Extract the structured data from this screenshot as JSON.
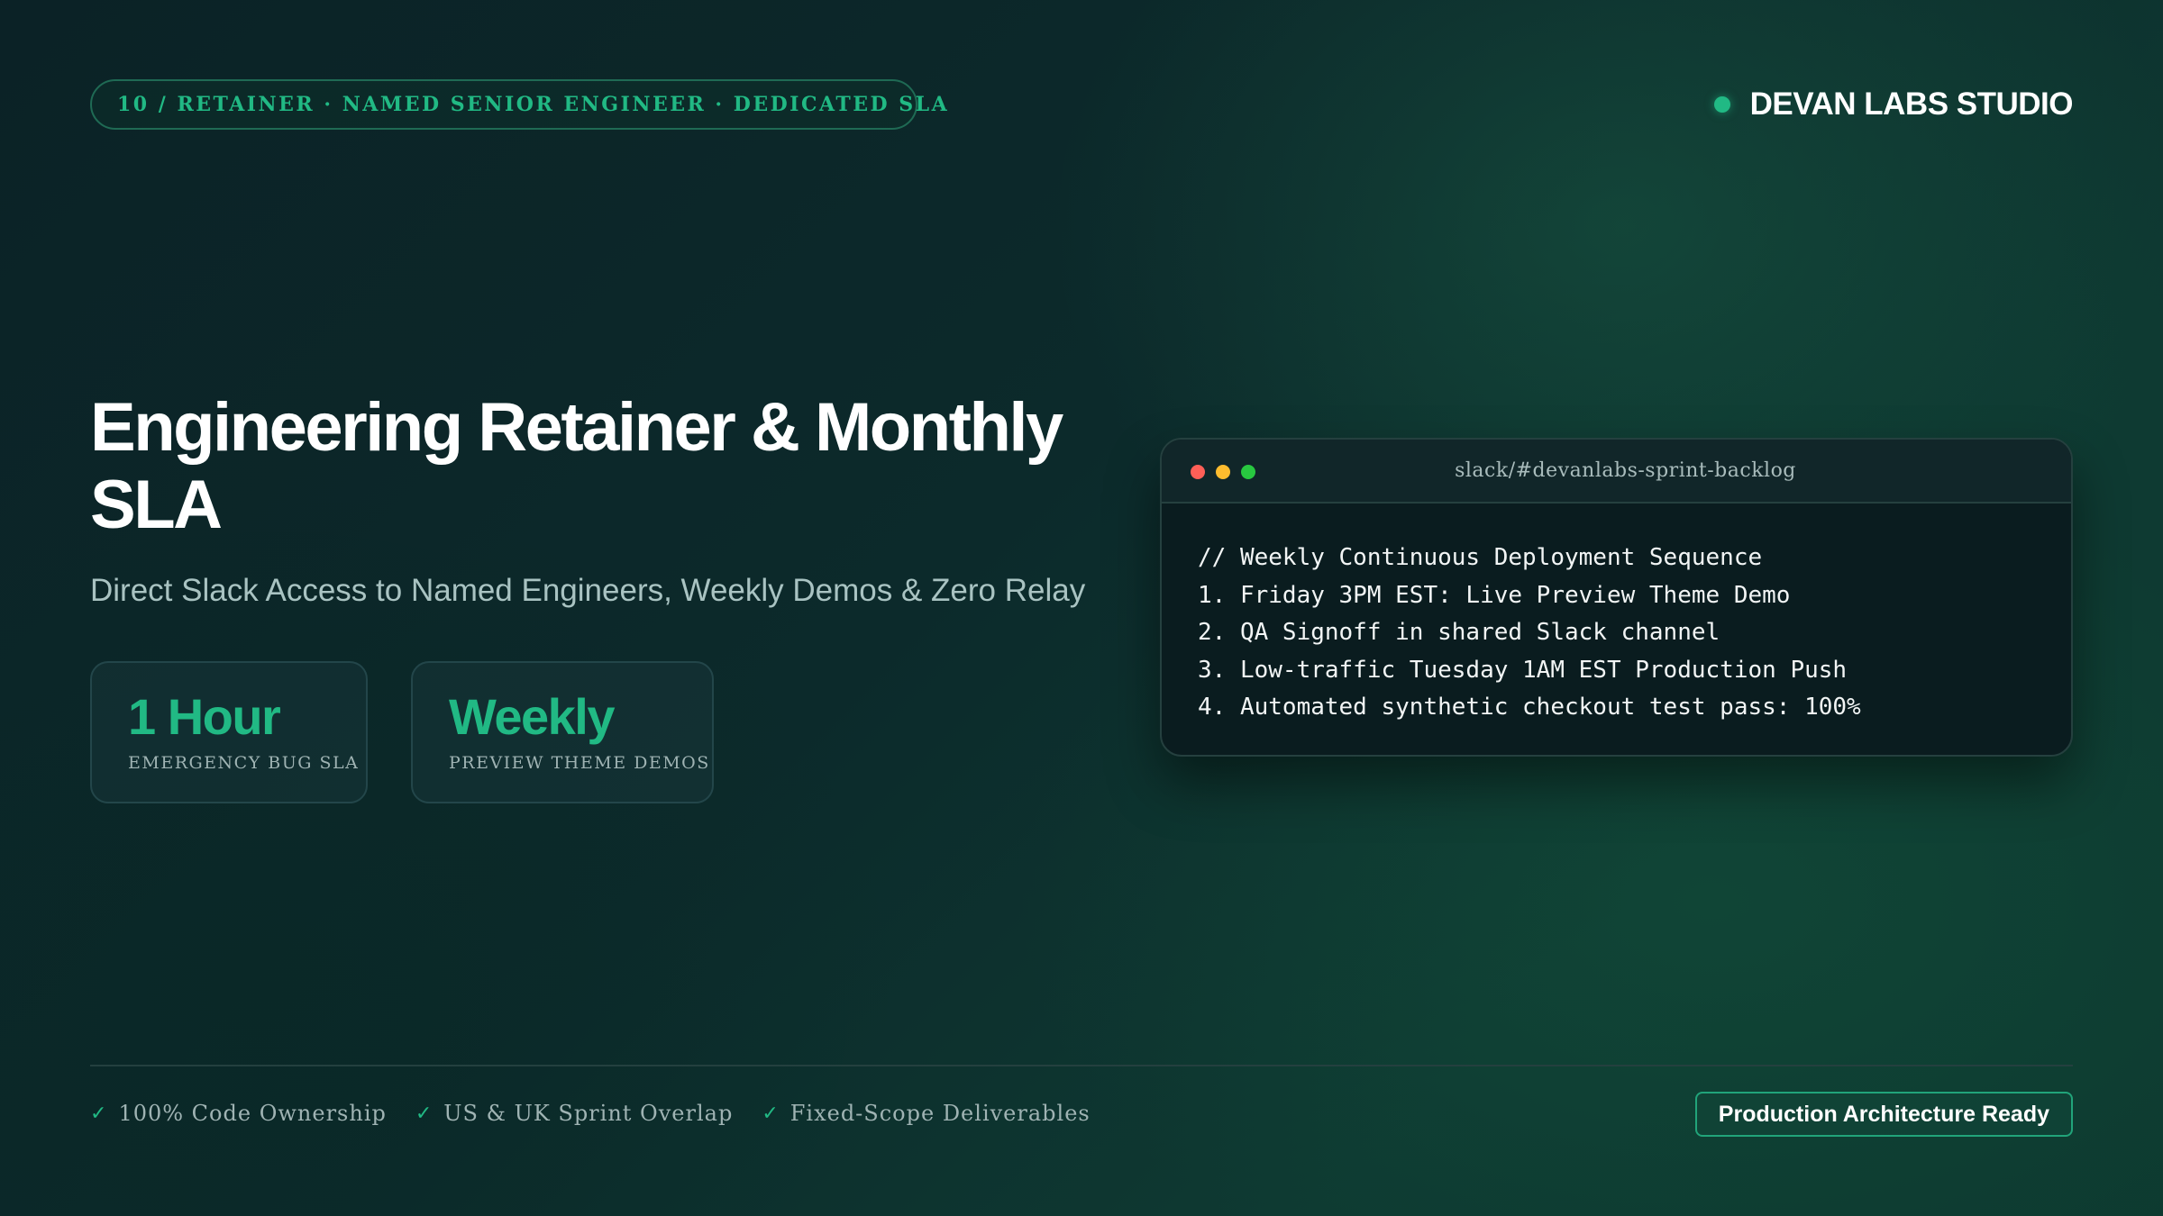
{
  "header": {
    "pill_text": "10 / RETAINER · NAMED SENIOR ENGINEER · DEDICATED SLA",
    "brand_name": "DEVAN LABS STUDIO"
  },
  "hero": {
    "title": "Engineering Retainer & Monthly SLA",
    "subtitle": "Direct Slack Access to Named Engineers, Weekly Demos & Zero Relay"
  },
  "stats": [
    {
      "value": "1 Hour",
      "label": "EMERGENCY BUG SLA"
    },
    {
      "value": "Weekly",
      "label": "PREVIEW THEME DEMOS"
    }
  ],
  "terminal": {
    "title": "slack/#devanlabs-sprint-backlog",
    "lines": [
      "// Weekly Continuous Deployment Sequence",
      "1. Friday 3PM EST: Live Preview Theme Demo",
      "2. QA Signoff in shared Slack channel",
      "3. Low-traffic Tuesday 1AM EST Production Push",
      "4. Automated synthetic checkout test pass: 100%"
    ]
  },
  "footer": {
    "features": [
      {
        "check": "✓",
        "label": "100% Code Ownership"
      },
      {
        "check": "✓",
        "label": "US & UK Sprint Overlap"
      },
      {
        "check": "✓",
        "label": "Fixed-Scope Deliverables"
      }
    ],
    "badge": "Production Architecture Ready"
  },
  "colors": {
    "accent": "#21b984",
    "background": "#0c2a2b"
  }
}
